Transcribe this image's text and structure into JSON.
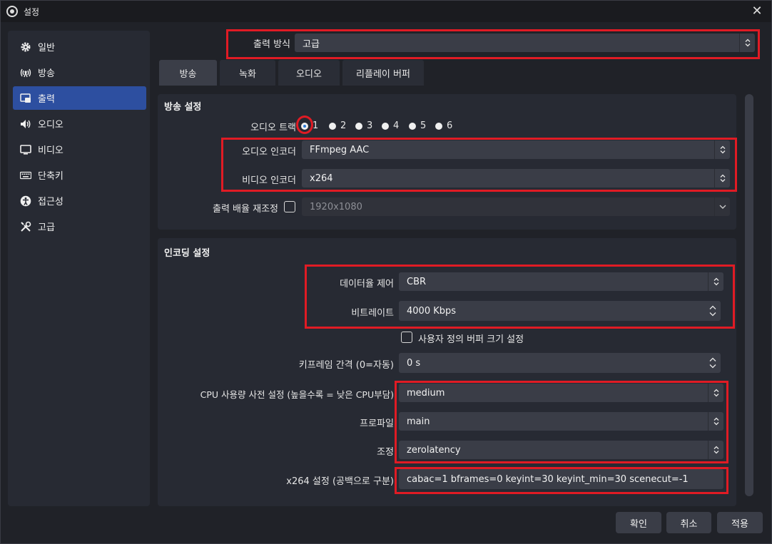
{
  "window": {
    "title": "설정",
    "close": "✕"
  },
  "sidebar": {
    "items": [
      {
        "label": "일반",
        "icon": "gear-icon"
      },
      {
        "label": "방송",
        "icon": "broadcast-icon"
      },
      {
        "label": "출력",
        "icon": "output-icon",
        "active": true
      },
      {
        "label": "오디오",
        "icon": "speaker-icon"
      },
      {
        "label": "비디오",
        "icon": "monitor-icon"
      },
      {
        "label": "단축키",
        "icon": "keyboard-icon"
      },
      {
        "label": "접근성",
        "icon": "accessibility-icon"
      },
      {
        "label": "고급",
        "icon": "tools-icon"
      }
    ]
  },
  "output_mode": {
    "label": "출력 방식",
    "value": "고급"
  },
  "tabs": [
    "방송",
    "녹화",
    "오디오",
    "리플레이 버퍼"
  ],
  "stream_settings": {
    "title": "방송 설정",
    "audio_track_label": "오디오 트랙",
    "tracks": [
      "1",
      "2",
      "3",
      "4",
      "5",
      "6"
    ],
    "audio_encoder_label": "오디오 인코더",
    "audio_encoder": "FFmpeg AAC",
    "video_encoder_label": "비디오 인코더",
    "video_encoder": "x264",
    "rescale_label": "출력 배율 재조정",
    "rescale_value": "1920x1080"
  },
  "encoder_settings": {
    "title": "인코딩 설정",
    "rate_control_label": "데이터율 제어",
    "rate_control": "CBR",
    "bitrate_label": "비트레이트",
    "bitrate": "4000 Kbps",
    "custom_buffer_label": "사용자 정의 버퍼 크기 설정",
    "keyframe_label": "키프레임 간격 (0=자동)",
    "keyframe": "0 s",
    "preset_label": "CPU 사용량 사전 설정 (높을수록 = 낮은 CPU부담)",
    "preset": "medium",
    "profile_label": "프로파일",
    "profile": "main",
    "tune_label": "조정",
    "tune": "zerolatency",
    "x264opts_label": "x264 설정 (공백으로 구분)",
    "x264opts": "cabac=1 bframes=0 keyint=30 keyint_min=30 scenecut=-1"
  },
  "buttons": {
    "ok": "확인",
    "cancel": "취소",
    "apply": "적용"
  },
  "colors": {
    "accent": "#2d4fa0",
    "highlight": "#e01b24"
  }
}
